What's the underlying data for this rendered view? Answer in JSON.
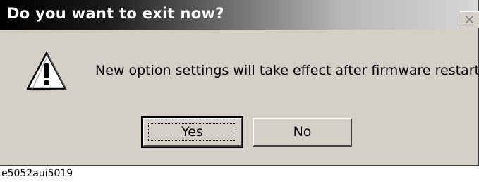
{
  "dialog": {
    "title": "Do you want to exit now?",
    "close_glyph": "✕",
    "icon": "warning-icon",
    "message": "New option settings will take effect after firmware restart.",
    "buttons": {
      "yes_label": "Yes",
      "no_label": "No"
    }
  },
  "caption": "e5052aui5019",
  "colors": {
    "dialog_bg": "#d4d0c8",
    "title_text": "#ffffff",
    "title_gradient_start": "#000000",
    "title_gradient_end": "#d6d6d6"
  }
}
